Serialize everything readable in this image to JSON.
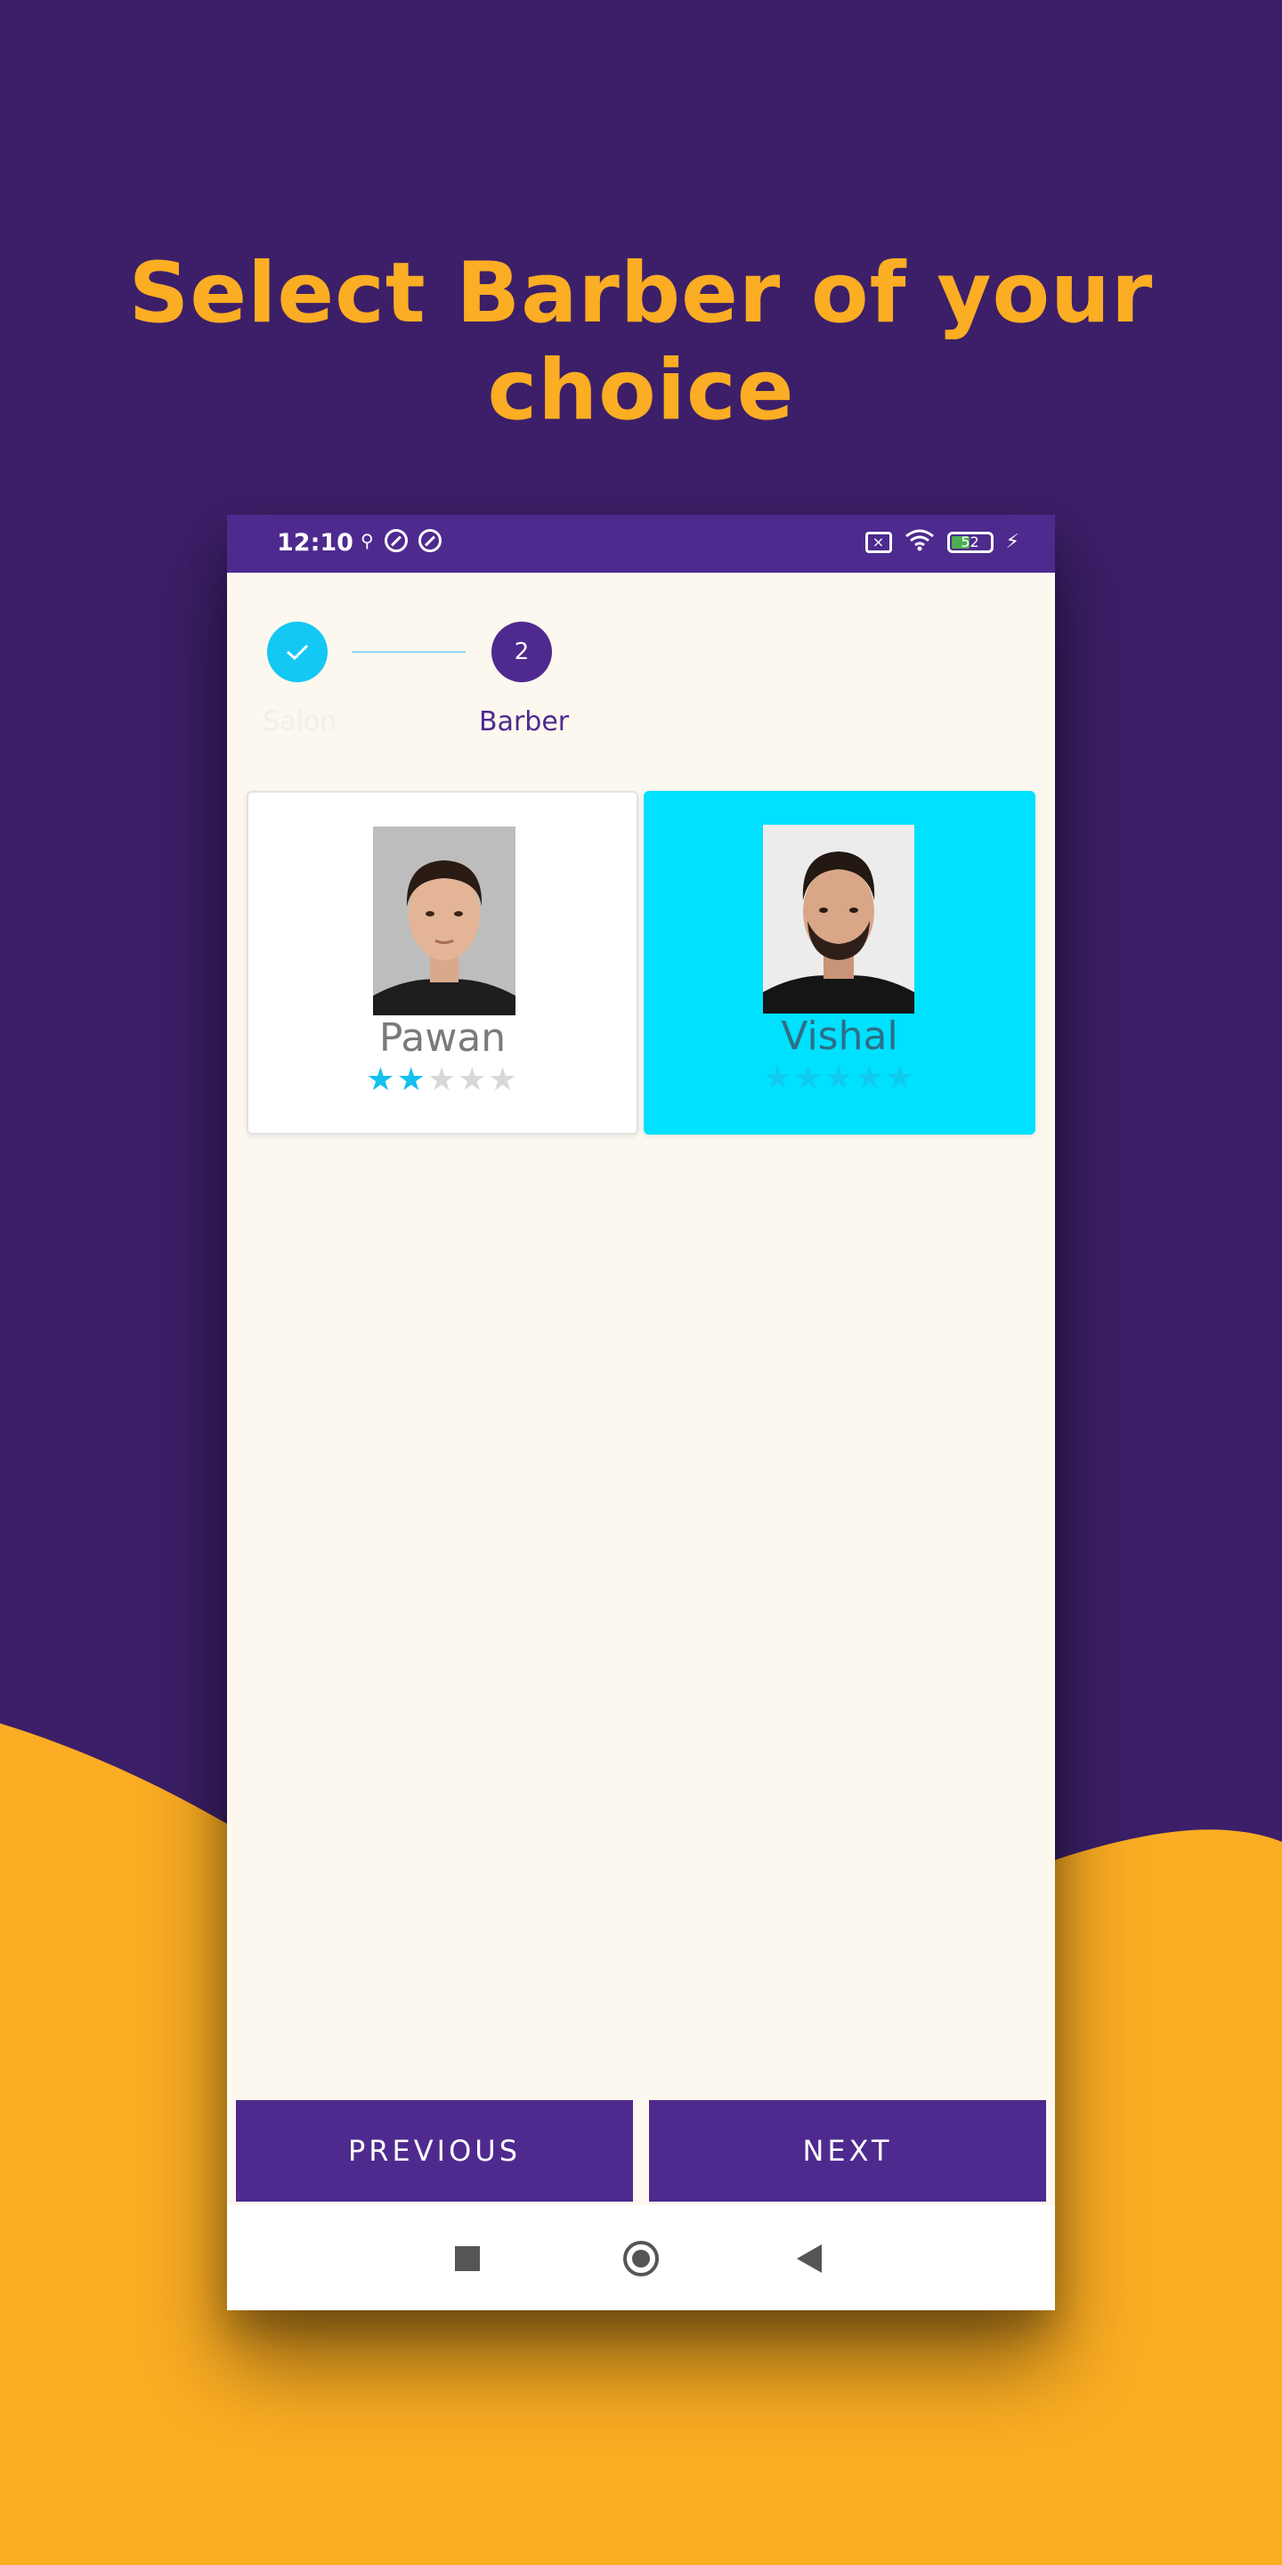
{
  "headline": "Select Barber of your choice",
  "status_bar": {
    "time": "12:10",
    "battery": "52"
  },
  "stepper": {
    "step1_label": "Salon",
    "step2_number": "2",
    "step2_label": "Barber"
  },
  "barbers": [
    {
      "name": "Pawan",
      "rating": 2,
      "max_rating": 5,
      "selected": false
    },
    {
      "name": "Vishal",
      "rating": 0,
      "max_rating": 5,
      "selected": true
    }
  ],
  "buttons": {
    "previous": "PREVIOUS",
    "next": "NEXT"
  },
  "colors": {
    "background_purple": "#3c1f68",
    "wave_yellow": "#fbad23",
    "accent_cyan": "#00e0ff",
    "primary_purple": "#4e2a8f",
    "screen_bg": "#fcf8ef"
  }
}
